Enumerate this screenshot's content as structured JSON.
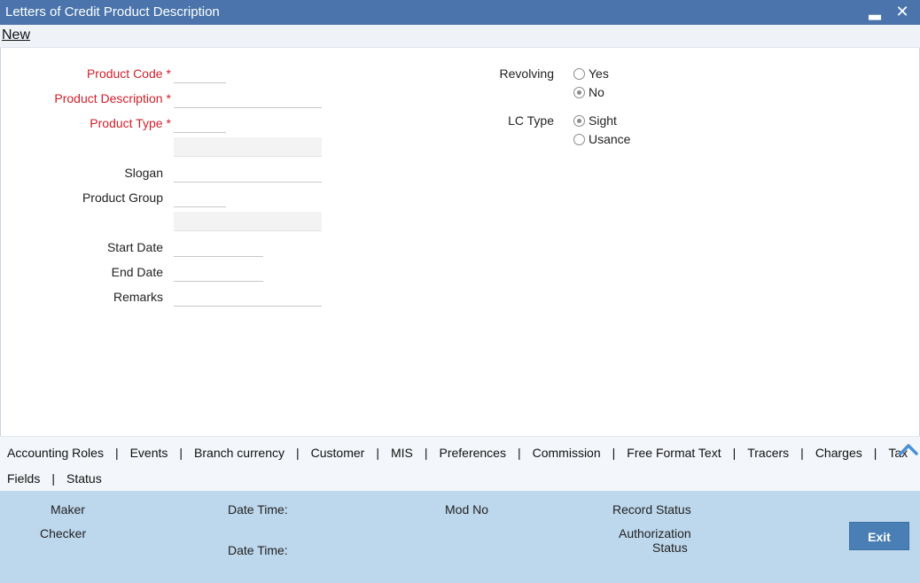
{
  "window": {
    "title": "Letters of Credit Product Description",
    "minimize_glyph": "▂",
    "close_glyph": "✕"
  },
  "menu": {
    "new_label": "New"
  },
  "form": {
    "product_code": {
      "label": "Product Code",
      "required_mark": "*",
      "value": ""
    },
    "product_description": {
      "label": "Product Description",
      "required_mark": "*",
      "value": ""
    },
    "product_type": {
      "label": "Product Type",
      "required_mark": "*",
      "value": "",
      "description": ""
    },
    "slogan": {
      "label": "Slogan",
      "value": ""
    },
    "product_group": {
      "label": "Product Group",
      "value": "",
      "description": ""
    },
    "start_date": {
      "label": "Start Date",
      "value": ""
    },
    "end_date": {
      "label": "End Date",
      "value": ""
    },
    "remarks": {
      "label": "Remarks",
      "value": ""
    },
    "revolving": {
      "label": "Revolving",
      "options": [
        {
          "label": "Yes",
          "checked": false
        },
        {
          "label": "No",
          "checked": true
        }
      ]
    },
    "lc_type": {
      "label": "LC Type",
      "options": [
        {
          "label": "Sight",
          "checked": true
        },
        {
          "label": "Usance",
          "checked": false
        }
      ]
    }
  },
  "tabs": {
    "line1": [
      "Accounting Roles",
      "Events",
      "Branch currency",
      "Customer",
      "MIS",
      "Preferences",
      "Commission",
      "Free Format Text",
      "Tracers",
      "Charges",
      "Tax"
    ],
    "line2": [
      "Fields",
      "Status"
    ],
    "separator": "|",
    "collapse_icon": "chevron-up-icon"
  },
  "footer": {
    "maker": "Maker",
    "checker": "Checker",
    "date_time_1": "Date Time:",
    "date_time_2": "Date Time:",
    "mod_no": "Mod No",
    "record_status": "Record Status",
    "authorization_status_line1": "Authorization",
    "authorization_status_line2": "Status",
    "exit_label": "Exit"
  },
  "colors": {
    "titlebar": "#4a74ab",
    "required_label": "#d0202b",
    "footer_bg": "#bdd7ec",
    "exit_button": "#4a7fb5"
  }
}
